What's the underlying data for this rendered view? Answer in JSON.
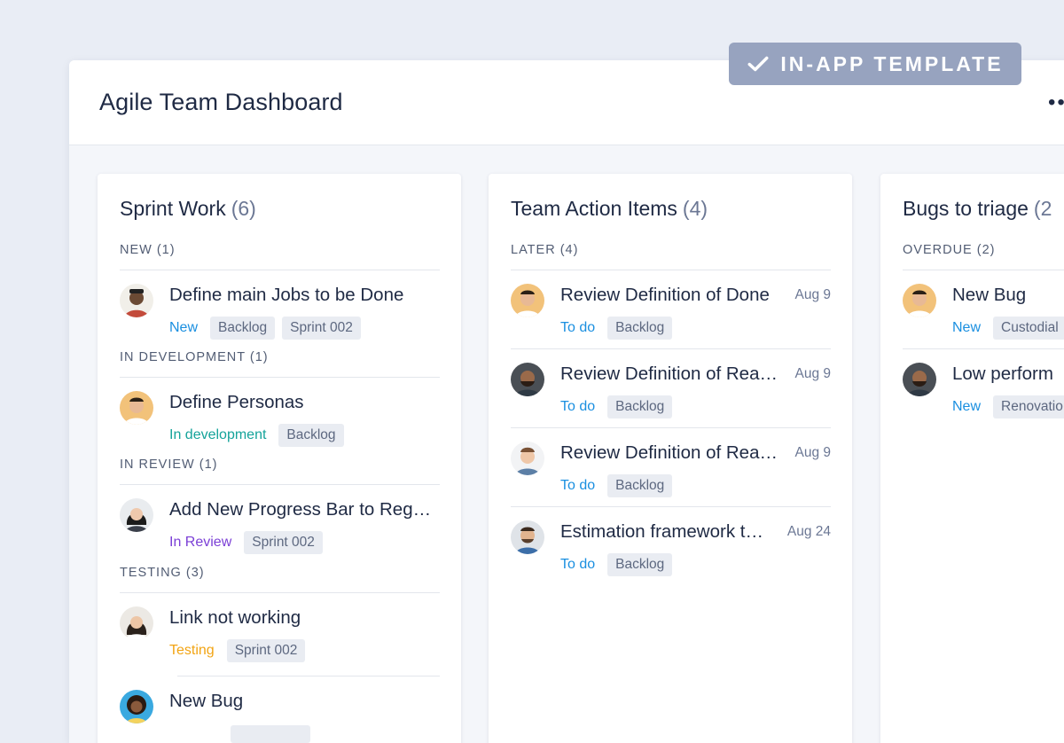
{
  "header": {
    "title": "Agile Team Dashboard",
    "more": "••"
  },
  "badge": {
    "label": "IN-APP TEMPLATE",
    "icon": "check-icon"
  },
  "colors": {
    "new": "#1a8fe0",
    "todo": "#1a8fe0",
    "in_development": "#14a39a",
    "in_review": "#7b3fd6",
    "testing": "#f2a413"
  },
  "columns": [
    {
      "name": "Sprint Work",
      "count": "(6)",
      "groups": [
        {
          "label": "NEW (1)",
          "items": [
            {
              "title": "Define main Jobs to be Done",
              "status": "New",
              "tags": [
                "Backlog",
                "Sprint 002"
              ]
            }
          ]
        },
        {
          "label": "IN DEVELOPMENT (1)",
          "items": [
            {
              "title": "Define Personas",
              "status": "In development",
              "tags": [
                "Backlog"
              ]
            }
          ]
        },
        {
          "label": "IN REVIEW (1)",
          "items": [
            {
              "title": "Add New Progress Bar to Reg…",
              "status": "In Review",
              "tags": [
                "Sprint 002"
              ]
            }
          ]
        },
        {
          "label": "TESTING (3)",
          "items": [
            {
              "title": "Link not working",
              "status": "Testing",
              "tags": [
                "Sprint 002"
              ]
            },
            {
              "title": "New Bug",
              "status": "",
              "tags": [
                ""
              ]
            }
          ]
        }
      ]
    },
    {
      "name": "Team Action Items",
      "count": "(4)",
      "groups": [
        {
          "label": "LATER (4)",
          "items": [
            {
              "title": "Review Definition of Done",
              "date": "Aug 9",
              "status": "To do",
              "tags": [
                "Backlog"
              ]
            },
            {
              "title": "Review Definition of Rea…",
              "date": "Aug 9",
              "status": "To do",
              "tags": [
                "Backlog"
              ]
            },
            {
              "title": "Review Definition of Rea…",
              "date": "Aug 9",
              "status": "To do",
              "tags": [
                "Backlog"
              ]
            },
            {
              "title": "Estimation framework t…",
              "date": "Aug 24",
              "status": "To do",
              "tags": [
                "Backlog"
              ]
            }
          ]
        }
      ]
    },
    {
      "name": "Bugs to triage",
      "count": "(2",
      "groups": [
        {
          "label": "OVERDUE (2)",
          "items": [
            {
              "title": "New Bug",
              "status": "New",
              "tags": [
                "Custodial"
              ]
            },
            {
              "title": "Low perform",
              "status": "New",
              "tags": [
                "Renovatio"
              ]
            }
          ]
        }
      ]
    }
  ]
}
